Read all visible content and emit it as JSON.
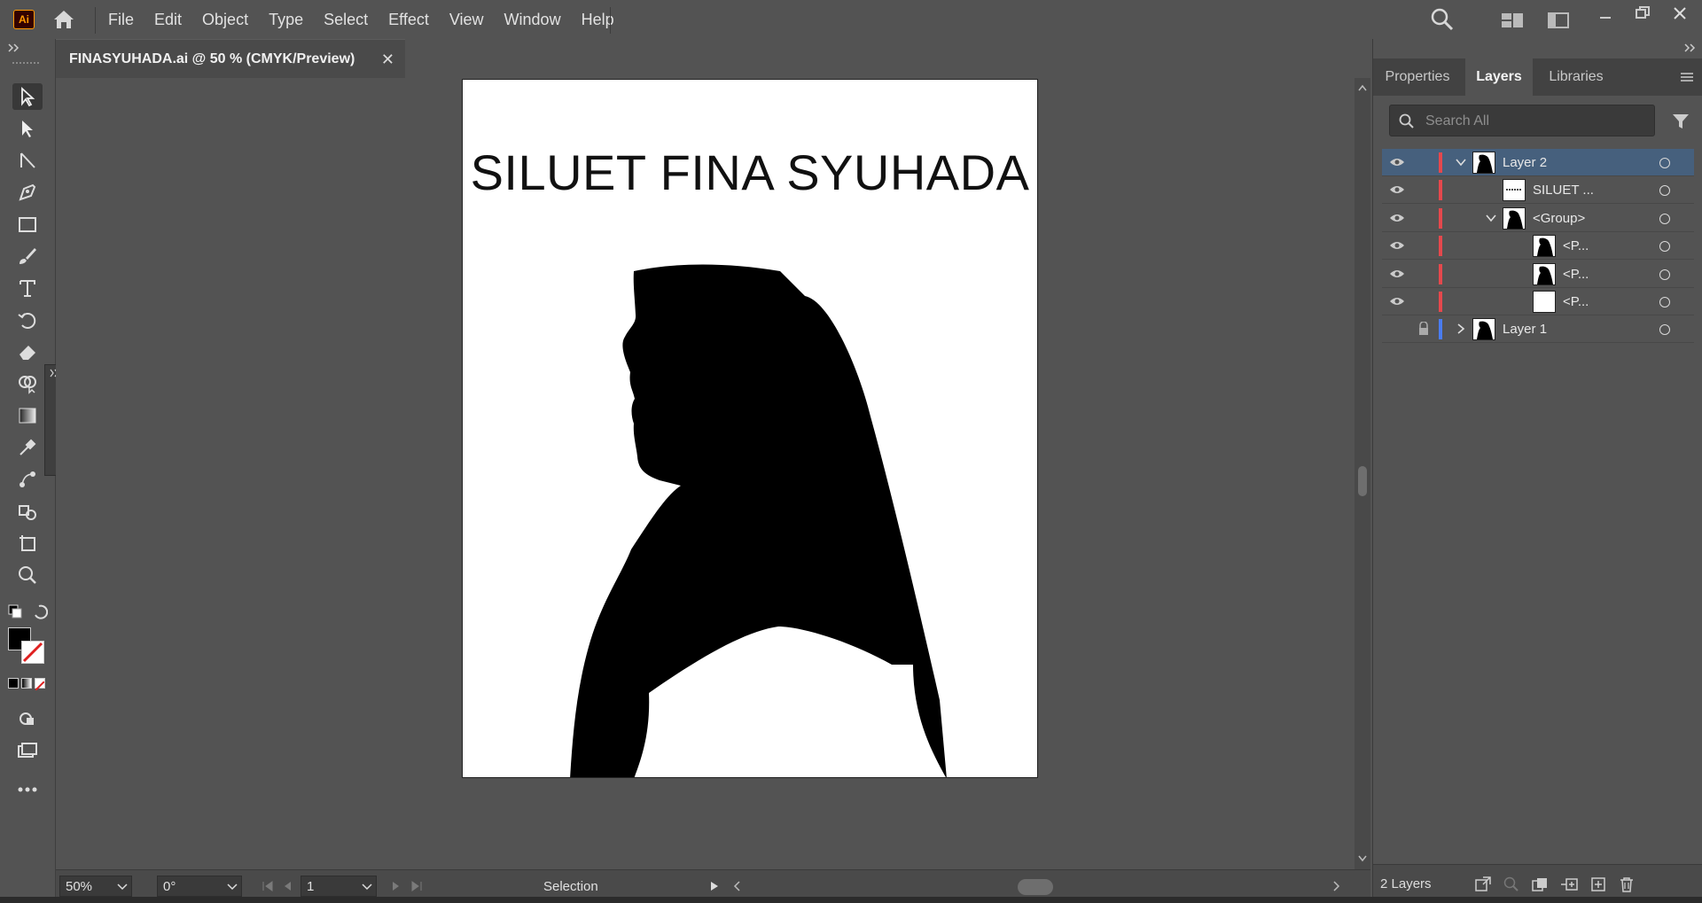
{
  "app": {
    "logo_text": "Ai",
    "menu": [
      "File",
      "Edit",
      "Object",
      "Type",
      "Select",
      "Effect",
      "View",
      "Window",
      "Help"
    ]
  },
  "document": {
    "tab_title": "FINASYUHADA.ai @ 50 % (CMYK/Preview)",
    "close_symbol": "✕"
  },
  "artboard": {
    "title_text": "SILUET FINA SYUHADA",
    "silhouette_fill": "#000000",
    "background": "#ffffff"
  },
  "statusbar": {
    "zoom": "50%",
    "rotation": "0°",
    "artboard_number": "1",
    "current_tool": "Selection"
  },
  "panel": {
    "tabs": [
      "Properties",
      "Layers",
      "Libraries"
    ],
    "active_tab": "Layers",
    "search_placeholder": "Search All",
    "layers": [
      {
        "name": "Layer 2",
        "depth": 0,
        "expanded": true,
        "selected": true,
        "locked": false,
        "visible": true,
        "color": "#e5484d"
      },
      {
        "name": "SILUET ...",
        "depth": 1,
        "expanded": null,
        "selected": false,
        "locked": false,
        "visible": true,
        "color": "#e5484d"
      },
      {
        "name": "<Group>",
        "depth": 1,
        "expanded": true,
        "selected": false,
        "locked": false,
        "visible": true,
        "color": "#e5484d"
      },
      {
        "name": "<P...",
        "depth": 2,
        "expanded": null,
        "selected": false,
        "locked": false,
        "visible": true,
        "color": "#e5484d"
      },
      {
        "name": "<P...",
        "depth": 2,
        "expanded": null,
        "selected": false,
        "locked": false,
        "visible": true,
        "color": "#e5484d"
      },
      {
        "name": "<P...",
        "depth": 2,
        "expanded": null,
        "selected": false,
        "locked": false,
        "visible": true,
        "color": "#e5484d"
      },
      {
        "name": "Layer 1",
        "depth": 0,
        "expanded": false,
        "selected": false,
        "locked": true,
        "visible": false,
        "color": "#4a7cf0"
      }
    ],
    "footer_count": "2 Layers"
  },
  "icons": {
    "tools": [
      "selection-tool-icon",
      "direct-selection-tool-icon",
      "line-tool-icon",
      "pen-tool-icon",
      "rectangle-tool-icon",
      "paintbrush-tool-icon",
      "type-tool-icon",
      "rotate-tool-icon",
      "eraser-tool-icon",
      "shape-builder-tool-icon",
      "gradient-tool-icon",
      "eyedropper-tool-icon",
      "blend-tool-icon",
      "symbol-sprayer-tool-icon",
      "artboard-tool-icon",
      "zoom-tool-icon"
    ]
  },
  "colors": {
    "ui_bg": "#535353",
    "selection_highlight": "#46607d",
    "brand_orange": "#ff9a00"
  }
}
